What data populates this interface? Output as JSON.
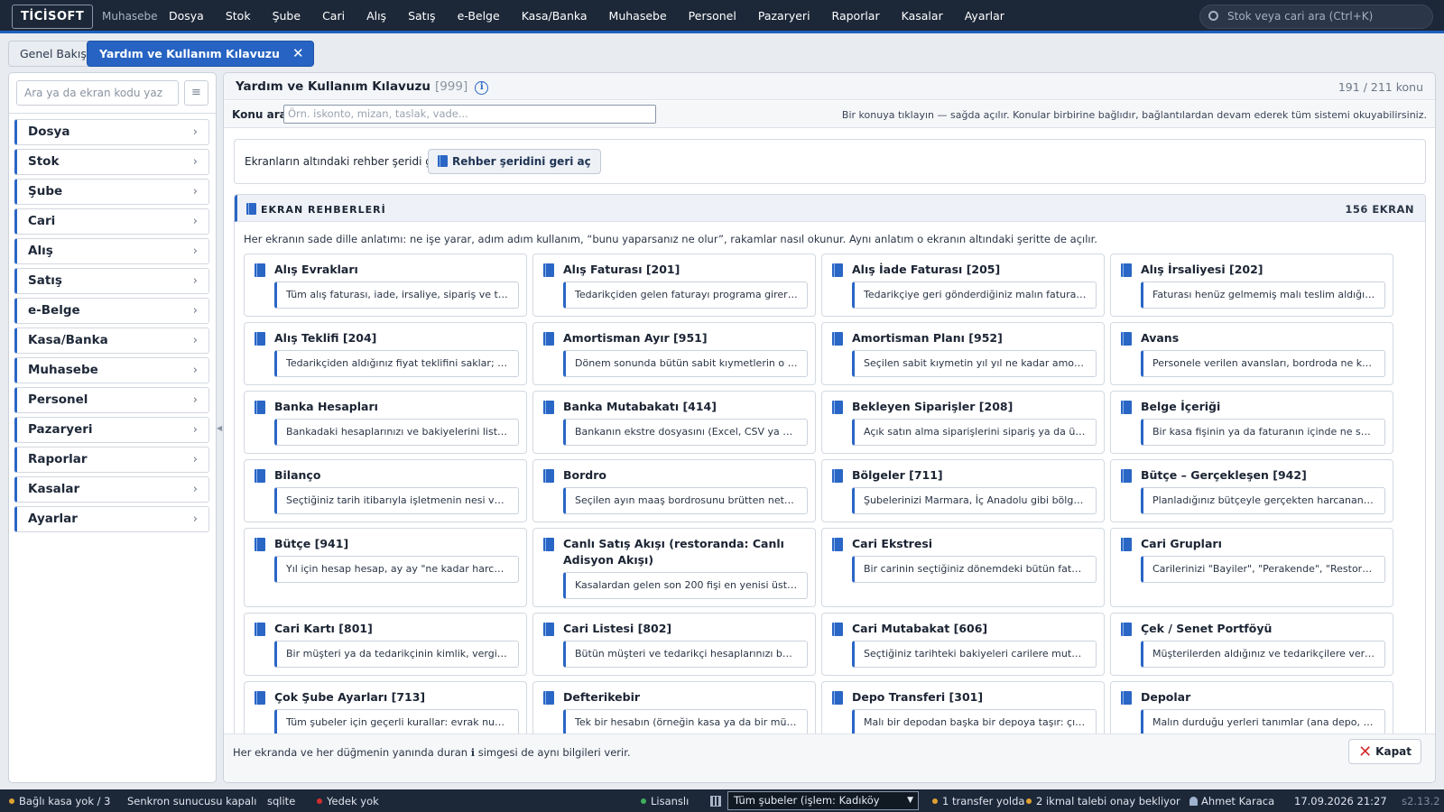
{
  "app": {
    "logo": "TİCİSOFT",
    "module": "Muhasebe"
  },
  "topnav": [
    "Dosya",
    "Stok",
    "Şube",
    "Cari",
    "Alış",
    "Satış",
    "e-Belge",
    "Kasa/Banka",
    "Muhasebe",
    "Personel",
    "Pazaryeri",
    "Raporlar",
    "Kasalar",
    "Ayarlar"
  ],
  "global_search": {
    "placeholder": "Stok veya cari ara (Ctrl+K)"
  },
  "tabs": {
    "overview": "Genel Bakış",
    "active": "Yardım ve Kullanım Kılavuzu",
    "close": "✕"
  },
  "sidebar": {
    "search_placeholder": "Ara ya da ekran kodu yaz",
    "items": [
      "Dosya",
      "Stok",
      "Şube",
      "Cari",
      "Alış",
      "Satış",
      "e-Belge",
      "Kasa/Banka",
      "Muhasebe",
      "Personel",
      "Pazaryeri",
      "Raporlar",
      "Kasalar",
      "Ayarlar"
    ]
  },
  "page": {
    "title": "Yardım ve Kullanım Kılavuzu",
    "code": "[999]",
    "topic_count": "191 / 211 konu",
    "topic_search_label": "Konu ara",
    "topic_search_placeholder": "Örn. iskonto, mizan, taslak, vade...",
    "hint": "Bir konuya tıklayın — sağda açılır. Konular birbirine bağlıdır, bağlantılardan devam ederek tüm sistemi okuyabilirsiniz.",
    "notice_text": "Ekranların altındaki rehber şeridi gizli.",
    "notice_button": "Rehber şeridini geri aç",
    "footer_text": "Her ekranda ve her düğmenin yanında duran ℹ simgesi de aynı bilgileri verir.",
    "close_button": "Kapat"
  },
  "section": {
    "title": "EKRAN REHBERLERİ",
    "count": "156 EKRAN",
    "description": "Her ekranın sade dille anlatımı: ne işe yarar, adım adım kullanım, “bunu yaparsanız ne olur”, rakamlar nasıl okunur. Aynı anlatım o ekranın altındaki şeritte de açılır.",
    "cards": [
      {
        "title": "Alış Evrakları",
        "desc": "Tüm alış faturası, iade, irsaliye, sipariş ve teklifl..."
      },
      {
        "title": "Alış Faturası [201]",
        "desc": "Tedarikçiden gelen faturayı programa girersiniz..."
      },
      {
        "title": "Alış İade Faturası [205]",
        "desc": "Tedarikçiye geri gönderdiğiniz malın faturasını k..."
      },
      {
        "title": "Alış İrsaliyesi [202]",
        "desc": "Faturası henüz gelmemiş malı teslim aldığınızda..."
      },
      {
        "title": "Alış Teklifi [204]",
        "desc": "Tedarikçiden aldığınız fiyat teklifini saklar; hiçbi..."
      },
      {
        "title": "Amortisman Ayır [951]",
        "desc": "Dönem sonunda bütün sabit kıymetlerin o dön..."
      },
      {
        "title": "Amortisman Planı [952]",
        "desc": "Seçilen sabit kıymetin yıl yıl ne kadar amortism..."
      },
      {
        "title": "Avans",
        "desc": "Personele verilen avansları, bordroda ne kadarı..."
      },
      {
        "title": "Banka Hesapları",
        "desc": "Bankadaki hesaplarınızı ve bakiyelerini listeler; ..."
      },
      {
        "title": "Banka Mutabakatı [414]",
        "desc": "Bankanın ekstre dosyasını (Excel, CSV ya da M..."
      },
      {
        "title": "Bekleyen Siparişler [208]",
        "desc": "Açık satın alma siparişlerini sipariş ya da ürün b..."
      },
      {
        "title": "Belge İçeriği",
        "desc": "Bir kasa fişinin ya da faturanın içinde ne satıldı..."
      },
      {
        "title": "Bilanço",
        "desc": "Seçtiğiniz tarih itibarıyla işletmenin nesi var (ak..."
      },
      {
        "title": "Bordro",
        "desc": "Seçilen ayın maaş bordrosunu brütten nete hes..."
      },
      {
        "title": "Bölgeler [711]",
        "desc": "Şubelerinizi Marmara, İç Anadolu gibi bölgelere..."
      },
      {
        "title": "Bütçe – Gerçekleşen [942]",
        "desc": "Planladığınız bütçeyle gerçekten harcanan/kaza..."
      },
      {
        "title": "Bütçe [941]",
        "desc": "Yıl için hesap hesap, ay ay \"ne kadar harcayaca..."
      },
      {
        "title": "Canlı Satış Akışı (restoranda: Canlı Adisyon Akışı)",
        "desc": "Kasalardan gelen son 200 fişi en yenisi üstte ol..."
      },
      {
        "title": "Cari Ekstresi",
        "desc": "Bir carinin seçtiğiniz dönemdeki bütün fatura, s..."
      },
      {
        "title": "Cari Grupları",
        "desc": "Carilerinizi \"Bayiler\", \"Perakende\", \"Restoranlar..."
      },
      {
        "title": "Cari Kartı [801]",
        "desc": "Bir müşteri ya da tedarikçinin kimlik, vergi, ileti..."
      },
      {
        "title": "Cari Listesi [802]",
        "desc": "Bütün müşteri ve tedarikçi hesaplarınızı bakiyel..."
      },
      {
        "title": "Cari Mutabakat [606]",
        "desc": "Seçtiğiniz tarihteki bakiyeleri carilere mutabaka..."
      },
      {
        "title": "Çek / Senet Portföyü",
        "desc": "Müşterilerden aldığınız ve tedarikçilere verdiğini..."
      },
      {
        "title": "Çok Şube Ayarları [713]",
        "desc": "Tüm şubeler için geçerli kurallar: evrak numara..."
      },
      {
        "title": "Defterikebir",
        "desc": "Tek bir hesabın (örneğin kasa ya da bir müşteri..."
      },
      {
        "title": "Depo Transferi [301]",
        "desc": "Malı bir depodan başka bir depoya taşır: çıkış d..."
      },
      {
        "title": "Depolar",
        "desc": "Malın durduğu yerleri tanımlar (ana depo, dükk..."
      }
    ]
  },
  "statusbar": {
    "kasa": "Bağlı kasa yok / 3",
    "sync": "Senkron sunucusu kapalı",
    "db": "sqlite",
    "backup": "Yedek yok",
    "license": "Lisanslı",
    "branch": "Tüm şubeler (işlem: Kadıköy Merkez)",
    "transfer": "1 transfer yolda",
    "supply": "2 ikmal talebi onay bekliyor",
    "user": "Ahmet Karaca",
    "datetime": "17.09.2026 21:27",
    "version": "s2.13.2"
  },
  "colors": {
    "accent": "#2a66c5",
    "topbar": "#1c2738",
    "danger": "#d32f2f",
    "warning": "#e0a030",
    "ok": "#3fae5a"
  }
}
